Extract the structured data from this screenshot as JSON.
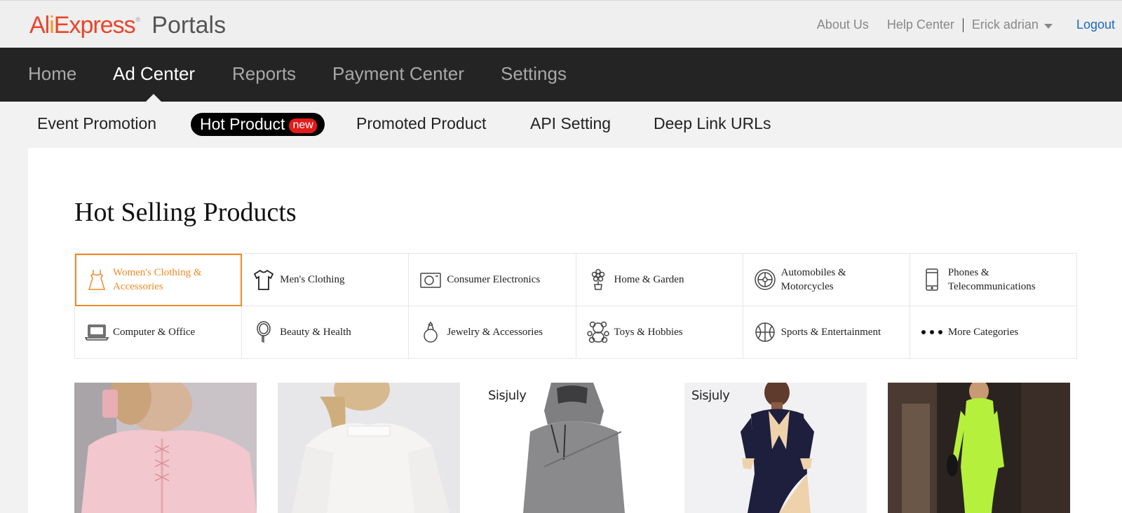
{
  "header": {
    "logo_text": "AliExpress",
    "logo_trademark": "®",
    "logo_subtitle": "Portals",
    "about": "About Us",
    "help": "Help Center",
    "user": "Erick adrian",
    "logout": "Logout"
  },
  "main_nav": [
    "Home",
    "Ad Center",
    "Reports",
    "Payment Center",
    "Settings"
  ],
  "sub_nav": {
    "event_promotion": "Event Promotion",
    "hot_product": "Hot Product",
    "hot_badge": "new",
    "promoted_product": "Promoted Product",
    "api_setting": "API Setting",
    "deep_link": "Deep Link URLs"
  },
  "page_title": "Hot Selling Products",
  "categories": [
    {
      "label": "Women's Clothing & Accessories",
      "icon": "dress-icon"
    },
    {
      "label": "Men's Clothing",
      "icon": "tshirt-icon"
    },
    {
      "label": "Consumer Electronics",
      "icon": "camera-icon"
    },
    {
      "label": "Home & Garden",
      "icon": "flower-icon"
    },
    {
      "label": "Automobiles & Motorcycles",
      "icon": "wheel-icon"
    },
    {
      "label": "Phones & Telecommunications",
      "icon": "phone-icon"
    },
    {
      "label": "Computer & Office",
      "icon": "laptop-icon"
    },
    {
      "label": "Beauty & Health",
      "icon": "mirror-icon"
    },
    {
      "label": "Jewelry & Accessories",
      "icon": "ring-icon"
    },
    {
      "label": "Toys & Hobbies",
      "icon": "teddy-bear-icon"
    },
    {
      "label": "Sports & Entertainment",
      "icon": "ball-icon"
    },
    {
      "label": "More Categories",
      "icon": "more-dots-icon"
    }
  ],
  "products": [
    {
      "brand": ""
    },
    {
      "brand": ""
    },
    {
      "brand": "Sisjuly"
    },
    {
      "brand": "Sisjuly"
    },
    {
      "brand": ""
    }
  ],
  "colors": {
    "accent": "#f08a28",
    "nav_bg": "#242424",
    "badge": "#e21b1b",
    "logout_link": "#1c67c8"
  }
}
